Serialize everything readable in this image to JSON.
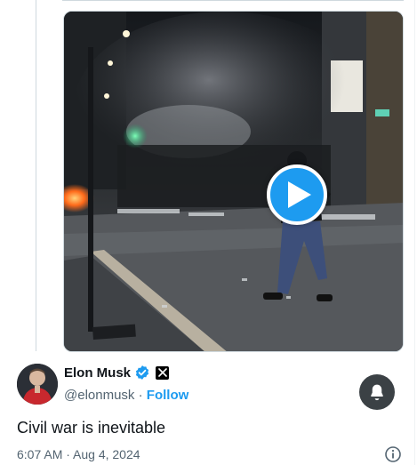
{
  "video": {
    "play_icon": "play-icon"
  },
  "author": {
    "name": "Elon Musk",
    "verified_icon": "verified-badge-icon",
    "affiliation_icon": "x-logo-icon",
    "handle": "@elonmusk",
    "separator": " · ",
    "follow_label": "Follow"
  },
  "actions": {
    "notification_icon": "bell-icon",
    "info_icon": "info-icon"
  },
  "tweet": {
    "text": "Civil war is inevitable",
    "timestamp": "6:07 AM · Aug 4, 2024"
  },
  "colors": {
    "accent": "#1d9bf0",
    "text_primary": "#0f1419",
    "text_secondary": "#536471"
  }
}
